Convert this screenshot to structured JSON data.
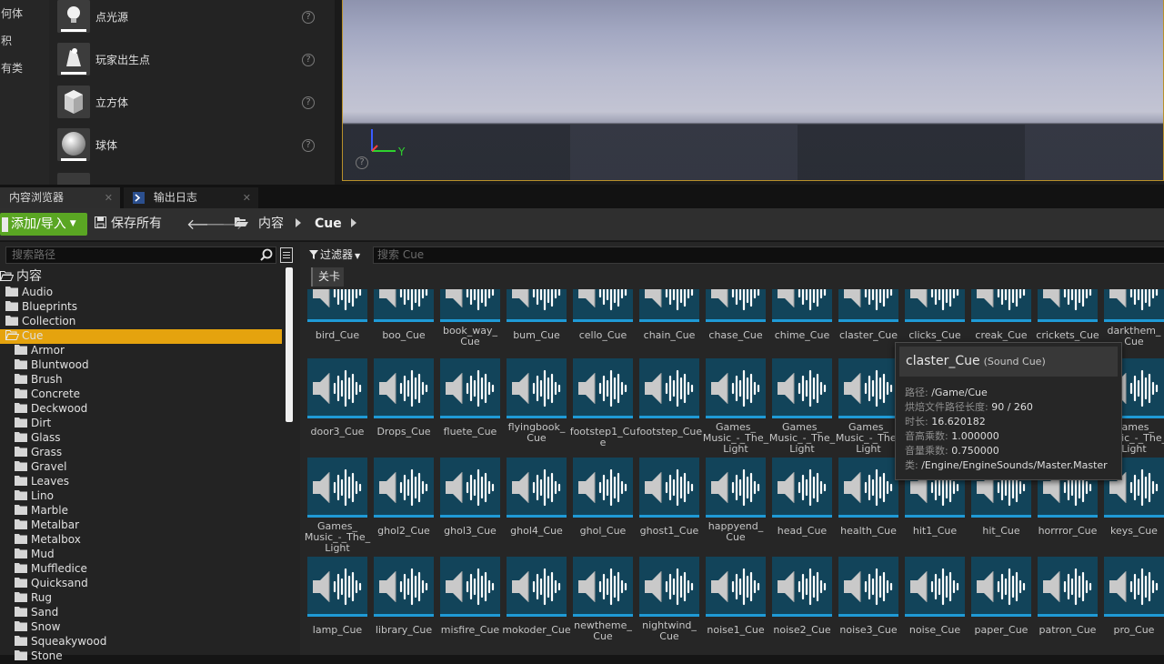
{
  "place_mode": {
    "categories": [
      "何体",
      "积",
      "有类"
    ],
    "items": [
      {
        "label": "点光源",
        "icon": "point-light-icon"
      },
      {
        "label": "玩家出生点",
        "icon": "player-start-icon"
      },
      {
        "label": "立方体",
        "icon": "cube-icon"
      },
      {
        "label": "球体",
        "icon": "sphere-icon"
      }
    ],
    "help_glyph": "?"
  },
  "viewport": {
    "axis_label": "Y",
    "help_glyph": "?"
  },
  "tabs": {
    "content_browser": "内容浏览器",
    "output_log": "输出日志",
    "close_glyph": "✕"
  },
  "toolbar": {
    "add_import": "添加/导入",
    "save_all": "保存所有",
    "breadcrumb_root": "内容",
    "breadcrumb_current": "Cue"
  },
  "tree": {
    "search_placeholder": "搜索路径",
    "root": "内容",
    "top_folders": [
      "Audio",
      "Blueprints",
      "Collection",
      "Cue"
    ],
    "cue_children": [
      "Armor",
      "Bluntwood",
      "Brush",
      "Concrete",
      "Deckwood",
      "Dirt",
      "Glass",
      "Grass",
      "Gravel",
      "Leaves",
      "Lino",
      "Marble",
      "Metalbar",
      "Metalbox",
      "Mud",
      "Muffledice",
      "Quicksand",
      "Rug",
      "Sand",
      "Snow",
      "Squeakywood",
      "Stone"
    ],
    "selected": "Cue"
  },
  "assets": {
    "filter_label": "过滤器",
    "search_placeholder": "搜索 Cue",
    "filter_chip": "关卡",
    "rows": [
      [
        "bird_Cue",
        "boo_Cue",
        "book_way_ Cue",
        "bum_Cue",
        "cello_Cue",
        "chain_Cue",
        "chase_Cue",
        "chime_Cue",
        "claster_Cue",
        "clicks_Cue",
        "creak_Cue",
        "crickets_Cue",
        "darkthem_ Cue"
      ],
      [
        "door3_Cue",
        "Drops_Cue",
        "fluete_Cue",
        "flyingbook_ Cue",
        "footstep1_Cue",
        "footstep_Cue",
        "Games_ Music_-_The_ Light",
        "Games_ Music_-_The_ Light",
        "Games_ Music_-_The_ Light",
        "",
        "",
        "",
        "Games_ Music_-_The_ Light"
      ],
      [
        "Games_ Music_-_The_ Light",
        "ghol2_Cue",
        "ghol3_Cue",
        "ghol4_Cue",
        "ghol_Cue",
        "ghost1_Cue",
        "happyend_ Cue",
        "head_Cue",
        "health_Cue",
        "hit1_Cue",
        "hit_Cue",
        "horrror_Cue",
        "keys_Cue"
      ],
      [
        "lamp_Cue",
        "library_Cue",
        "misfire_Cue",
        "mokoder_Cue",
        "newtheme_ Cue",
        "nightwind_ Cue",
        "noise1_Cue",
        "noise2_Cue",
        "noise3_Cue",
        "noise_Cue",
        "paper_Cue",
        "patron_Cue",
        "pro_Cue"
      ]
    ]
  },
  "tooltip": {
    "name": "claster_Cue",
    "type": "(Sound Cue)",
    "lines": [
      {
        "key": "路径: ",
        "value": "/Game/Cue"
      },
      {
        "key": "烘焙文件路径长度: ",
        "value": "90 / 260"
      },
      {
        "key": "时长: ",
        "value": "16.620182"
      },
      {
        "key": "音高乘数: ",
        "value": "1.000000"
      },
      {
        "key": "音量乘数: ",
        "value": "0.750000"
      },
      {
        "key": "类: ",
        "value": "/Engine/EngineSounds/Master.Master"
      }
    ]
  },
  "colors": {
    "selection": "#e5a30e",
    "add_button": "#5aa623",
    "viewport_border": "#b8902a",
    "tile_underline": "#1f9ad6"
  }
}
